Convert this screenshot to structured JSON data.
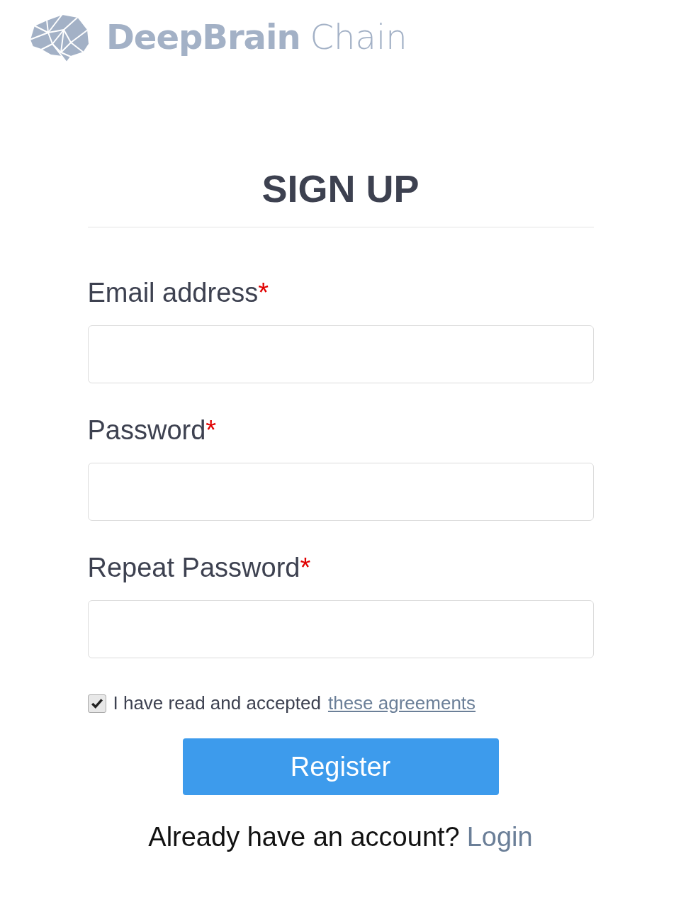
{
  "logo": {
    "bold": "DeepBrain",
    "light": "Chain"
  },
  "title": "SIGN UP",
  "fields": [
    {
      "label": "Email address",
      "required_mark": "*"
    },
    {
      "label": "Password",
      "required_mark": "*"
    },
    {
      "label": "Repeat Password",
      "required_mark": "*"
    }
  ],
  "agreement": {
    "checked": true,
    "text": "I have read and accepted",
    "link": "these agreements"
  },
  "register_button": "Register",
  "login_prompt": {
    "text": "Already have an account?",
    "link": "Login"
  }
}
